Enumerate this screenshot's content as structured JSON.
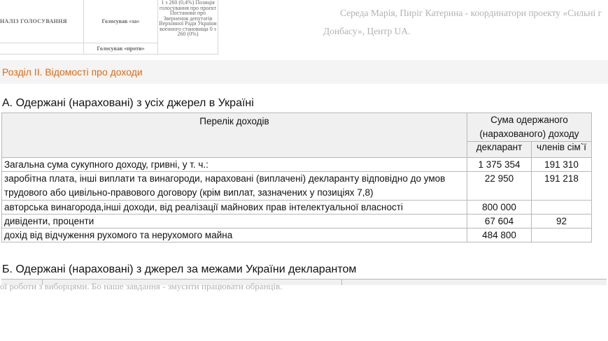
{
  "vote_table": {
    "analysis_label": "НАЛІЗ ГОЛОСУВАННЯ",
    "for_label": "Голосував «за»",
    "against_label": "Голосував «проти»",
    "note_text": "1 з 260 (0,4%) Позиція голосування про проєкт Постанови про Звернення депутатів Верховної Ради України воєнного становища 0 з 260 (0%)"
  },
  "right_text": {
    "line1": "Середа Марія, Пиріг Катерина - координатори проекту «Сильні г",
    "line2": "Донбасу», Центр UA."
  },
  "declaration": {
    "section_title": "Розділ ІІ. Відомості про доходи",
    "heading_a": "А. Одержані (нараховані) з усіх джерел в Україні",
    "columns": {
      "list_header": "Перелік доходів",
      "sum_header_line1": "Сума одержаного",
      "sum_header_line2": "(нарахованого) доходу",
      "declarant": "декларант",
      "family": "членів сім`ї"
    },
    "rows": [
      {
        "label": "Загальна сума сукупного доходу, гривні, у т. ч.:",
        "declarant": "1 375 354",
        "family": "191 310"
      },
      {
        "label": "заробітна плата, інші виплати та винагороди, нараховані (виплачені) декларанту відповідно до умов трудового або цивільно-правового договору (крім виплат, зазначених у позиціях 7,8)",
        "declarant": "22 950",
        "family": "191 218"
      },
      {
        "label": "авторська винагорода,інші доходи, від реалізації майнових прав інтелектуальної власності",
        "declarant": "800 000",
        "family": ""
      },
      {
        "label": "дивіденти, проценти",
        "declarant": "67 604",
        "family": "92"
      },
      {
        "label": "дохід від відчуження рухомого та нерухомого майна",
        "declarant": "484 800",
        "family": ""
      }
    ],
    "heading_b": "Б. Одержані (нараховані) з джерел за межами України декларантом"
  },
  "bottom_text": "ої роботи з виборцями. Бо наше завдання - змусити працювати обранців."
}
